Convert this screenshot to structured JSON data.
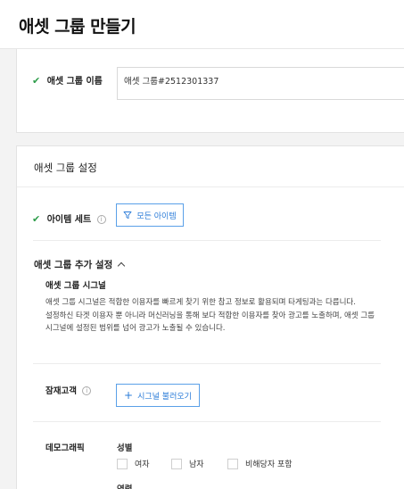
{
  "page": {
    "title": "애셋 그룹 만들기"
  },
  "asset_group_name": {
    "label": "애셋 그룹 이름",
    "value": "애셋 그룹#2512301337"
  },
  "settings": {
    "title": "애셋 그룹 설정",
    "items": {
      "label": "아이템 세트",
      "info_icon": "i",
      "button_label": "모든 아이템"
    },
    "additional": {
      "title": "애셋 그룹 추가 설정",
      "signal": {
        "title": "애셋 그룹 시그널",
        "desc_line1": "애셋 그룹 시그널은 적합한 이용자를 빠르게 찾기 위한 참고 정보로 활용되며 타게팅과는 다릅니다.",
        "desc_line2": "설정하신 타겟 이용자 뿐 아니라 머신러닝을 통해 보다 적합한 이용자를 찾아 광고를 노출하며, 애셋 그룹 시그널에 설정된 범위를 넘어 광고가 노출될 수 있습니다."
      },
      "prospects": {
        "label": "잠재고객",
        "info_icon": "i",
        "button_label": "시그널 불러오기"
      },
      "demographics": {
        "label": "데모그래픽",
        "gender_label": "성별",
        "gender_options": [
          "여자",
          "남자",
          "비해당자 포함"
        ],
        "age_label": "연령"
      }
    }
  },
  "colors": {
    "accent": "#2a7bd8",
    "check": "#2e9d4a"
  }
}
